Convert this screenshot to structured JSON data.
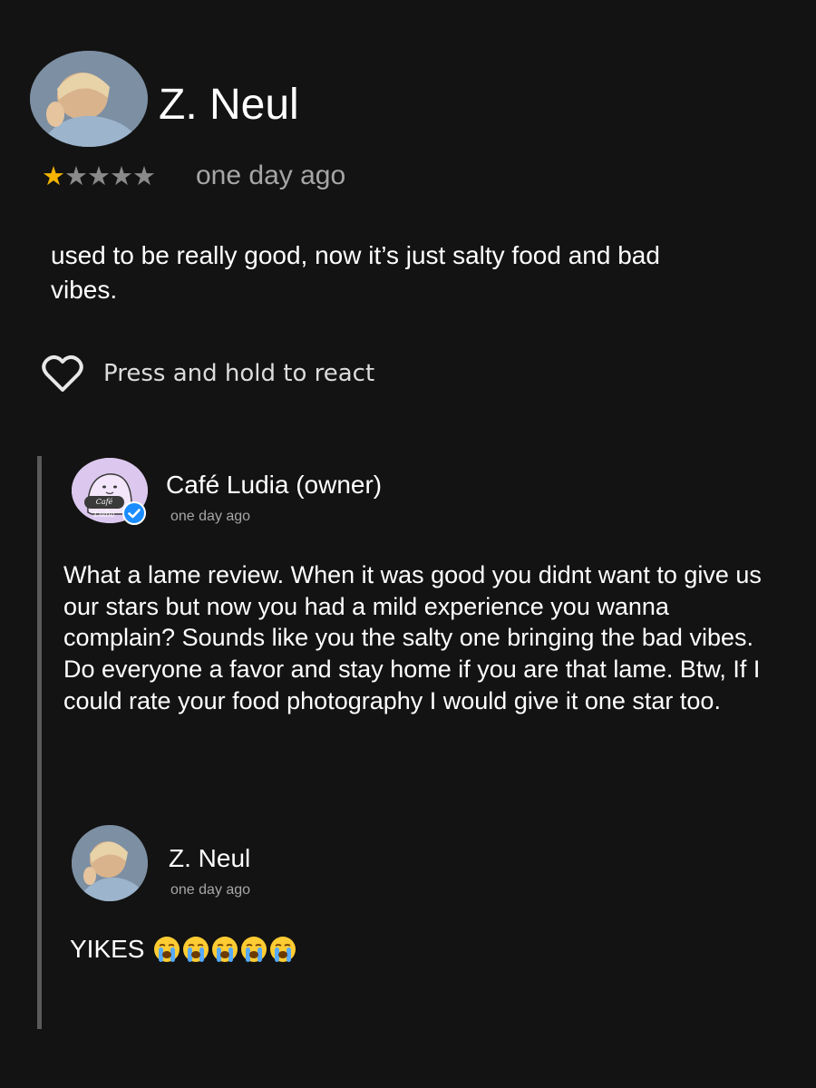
{
  "review": {
    "reviewer_name": "Z. Neul",
    "rating": 1,
    "rating_max": 5,
    "stars": [
      "★",
      "★",
      "★",
      "★",
      "★"
    ],
    "time": "one day ago",
    "text": "used to be really good, now it’s just salty food and bad vibes.",
    "react_label": "Press and hold to react",
    "icons": {
      "react": "heart-outline-icon",
      "avatar": "reviewer-avatar-photo"
    }
  },
  "owner_reply": {
    "name": "Café Ludia",
    "role_tag": "(owner)",
    "logo_text": "Café Ludia",
    "time": "one day ago",
    "text": "What a lame review.  When it was good you didnt want to give us our stars but now you had a mild experience you wanna complain? Sounds like you the salty one bringing the bad vibes.  Do everyone a favor and stay home if you are that lame.  Btw, If I could rate your food photography I would give it one star too.",
    "icons": {
      "badge": "verified-check-icon"
    }
  },
  "follow_up": {
    "name": "Z. Neul",
    "time": "one day ago",
    "text": "YIKES",
    "emoji_count": 5,
    "icons": {
      "emoji": "loudly-crying-face-icon"
    }
  },
  "colors": {
    "background": "#131313",
    "star_filled": "#f4b400",
    "star_empty": "#8a8a8a",
    "muted_text": "#a6a6a6",
    "verified_blue": "#1a8cff",
    "owner_avatar_bg": "#dcc8ee",
    "thread_line": "#5a5a5a"
  }
}
